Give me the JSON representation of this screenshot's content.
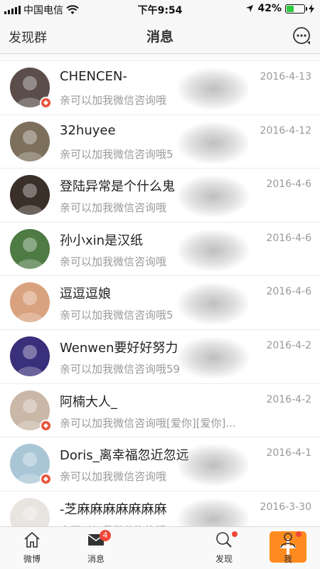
{
  "status_bar": {
    "carrier": "中国电信",
    "time": "下午9:54",
    "battery_text": "42%",
    "battery_level": 0.42
  },
  "nav": {
    "left_label": "发现群",
    "title": "消息"
  },
  "conversations": [
    {
      "name": "CHENCEN-",
      "date": "2016-4-13",
      "message": "亲可以加我微信咨询哦",
      "verified": true,
      "avatar_color": "#5a4d4a"
    },
    {
      "name": "32huyee",
      "date": "2016-4-12",
      "message": "亲可以加我微信咨询哦5",
      "verified": false,
      "avatar_color": "#7c6f5c"
    },
    {
      "name": "登陆异常是个什么鬼",
      "date": "2016-4-6",
      "message": "亲可以加我微信咨询哦",
      "verified": false,
      "avatar_color": "#3b2f2a"
    },
    {
      "name": "孙小xin是汉纸",
      "date": "2016-4-6",
      "message": "亲可以加我微信咨询哦",
      "verified": false,
      "avatar_color": "#4e7a44"
    },
    {
      "name": "逗逗逗娘",
      "date": "2016-4-6",
      "message": "亲可以加我微信咨询哦5",
      "verified": false,
      "avatar_color": "#d9a27e"
    },
    {
      "name": "Wenwen要好好努力",
      "date": "2016-4-2",
      "message": "亲可以加我微信咨询哦59",
      "verified": false,
      "avatar_color": "#3a2f7a"
    },
    {
      "name": "阿楠大人_",
      "date": "2016-4-2",
      "message": "亲可以加我微信咨询哦[爱你][爱你]...",
      "verified": true,
      "avatar_color": "#c9b7a8"
    },
    {
      "name": "Doris_离幸福忽近忽远",
      "date": "2016-4-1",
      "message": "亲可以加我微信咨询哦",
      "verified": true,
      "avatar_color": "#a9c6d6"
    },
    {
      "name": "-芝麻麻麻麻麻麻麻",
      "date": "2016-3-30",
      "message": "亲可以加我微信咨询哦",
      "verified": false,
      "avatar_color": "#e8e4df"
    }
  ],
  "tabs": [
    {
      "label": "微博",
      "icon": "home-icon"
    },
    {
      "label": "消息",
      "icon": "message-icon",
      "badge": "4"
    },
    {
      "label": "",
      "icon": "plus-icon"
    },
    {
      "label": "发现",
      "icon": "discover-icon"
    },
    {
      "label": "我",
      "icon": "profile-icon"
    }
  ],
  "colors": {
    "accent": "#ff8b1f",
    "badge": "#f0473a",
    "verified": "#e8543c"
  }
}
